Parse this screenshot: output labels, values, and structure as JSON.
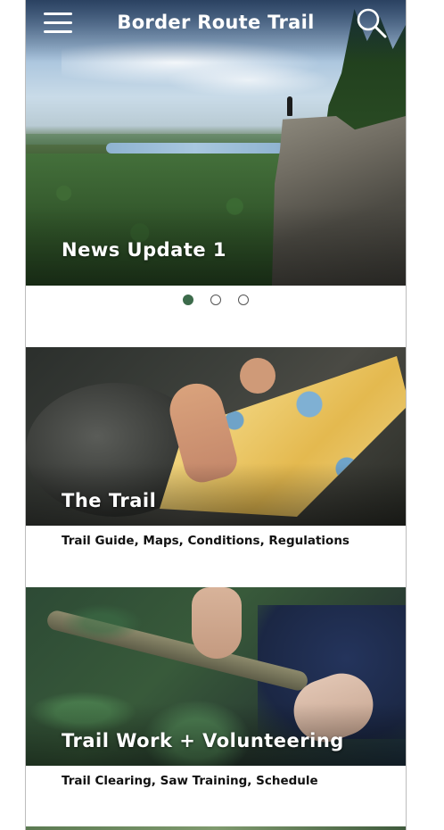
{
  "header": {
    "title": "Border Route Trail",
    "menu_icon": "hamburger-menu-icon",
    "search_icon": "search-icon"
  },
  "hero": {
    "caption": "News Update 1",
    "slides_count": 3,
    "active_slide": 1
  },
  "cards": [
    {
      "title": "The Trail",
      "subtitle": "Trail Guide, Maps, Conditions, Regulations"
    },
    {
      "title": "Trail Work + Volunteering",
      "subtitle": "Trail Clearing, Saw Training, Schedule"
    }
  ],
  "colors": {
    "accent": "#3c6b4b",
    "text": "#111111",
    "header_text": "#ffffff"
  }
}
